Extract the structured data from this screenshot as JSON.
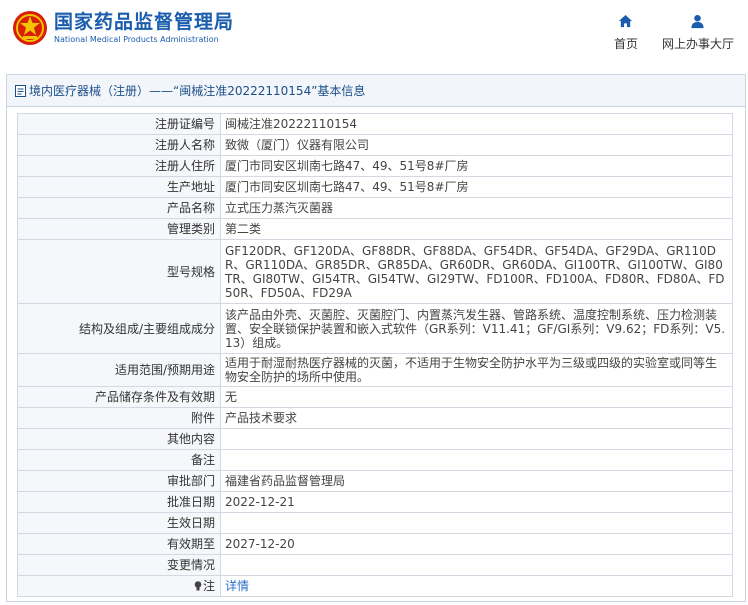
{
  "header": {
    "title_cn": "国家药品监督管理局",
    "title_en": "National Medical Products Administration",
    "nav": [
      {
        "label": "首页",
        "icon": "home-icon"
      },
      {
        "label": "网上办事大厅",
        "icon": "user-icon"
      }
    ]
  },
  "panel": {
    "title": "境内医疗器械（注册）——“闽械注准20222110154”基本信息"
  },
  "rows": [
    {
      "label": "注册证编号",
      "value": "闽械注准20222110154"
    },
    {
      "label": "注册人名称",
      "value": "致微（厦门）仪器有限公司"
    },
    {
      "label": "注册人住所",
      "value": "厦门市同安区圳南七路47、49、51号8#厂房"
    },
    {
      "label": "生产地址",
      "value": "厦门市同安区圳南七路47、49、51号8#厂房"
    },
    {
      "label": "产品名称",
      "value": "立式压力蒸汽灭菌器"
    },
    {
      "label": "管理类别",
      "value": "第二类"
    },
    {
      "label": "型号规格",
      "value": "GF120DR、GF120DA、GF88DR、GF88DA、GF54DR、GF54DA、GF29DA、GR110DR、GR110DA、GR85DR、GR85DA、GR60DR、GR60DA、GI100TR、GI100TW、GI80TR、GI80TW、GI54TR、GI54TW、GI29TW、FD100R、FD100A、FD80R、FD80A、FD50R、FD50A、FD29A"
    },
    {
      "label": "结构及组成/主要组成成分",
      "value": "该产品由外壳、灭菌腔、灭菌腔门、内置蒸汽发生器、管路系统、温度控制系统、压力检测装置、安全联锁保护装置和嵌入式软件（GR系列：V11.41；GF/GI系列：V9.62；FD系列：V5.13）组成。"
    },
    {
      "label": "适用范围/预期用途",
      "value": "适用于耐湿耐热医疗器械的灭菌，不适用于生物安全防护水平为三级或四级的实验室或同等生物安全防护的场所中使用。"
    },
    {
      "label": "产品储存条件及有效期",
      "value": "无"
    },
    {
      "label": "附件",
      "value": "产品技术要求"
    },
    {
      "label": "其他内容",
      "value": ""
    },
    {
      "label": "备注",
      "value": ""
    },
    {
      "label": "审批部门",
      "value": "福建省药品监督管理局"
    },
    {
      "label": "批准日期",
      "value": "2022-12-21"
    },
    {
      "label": "生效日期",
      "value": ""
    },
    {
      "label": "有效期至",
      "value": "2027-12-20"
    },
    {
      "label": "变更情况",
      "value": ""
    }
  ],
  "note": {
    "label": "注",
    "link": "详情"
  }
}
